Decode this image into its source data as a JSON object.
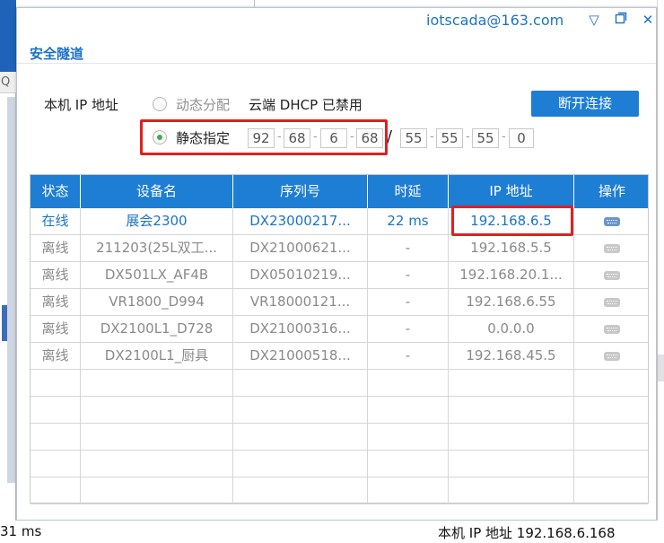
{
  "window": {
    "account": "iotscada@163.com",
    "title": "安全隧道"
  },
  "tunnel": {
    "local_ip_label": "本机 IP 地址",
    "mode_dynamic_label": "动态分配",
    "cloud_dhcp_label": "云端 DHCP 已禁用",
    "mode_static_label": "静态指定",
    "selected_mode": "静态指定",
    "ip": [
      "92",
      "68",
      "6",
      "68"
    ],
    "mask": [
      "55",
      "55",
      "55",
      "0"
    ],
    "disconnect_label": "断开连接"
  },
  "table": {
    "columns": [
      "状态",
      "设备名",
      "序列号",
      "时延",
      "IP 地址",
      "操作"
    ],
    "rows": [
      {
        "status": "在线",
        "name": "展会2300",
        "serial": "DX23000217...",
        "latency": "22 ms",
        "ip": "192.168.6.5",
        "online": true
      },
      {
        "status": "离线",
        "name": "211203(25L双工...",
        "serial": "DX21000621...",
        "latency": "-",
        "ip": "192.168.5.5",
        "online": false
      },
      {
        "status": "离线",
        "name": "DX501LX_AF4B",
        "serial": "DX05010219...",
        "latency": "-",
        "ip": "192.168.20.1...",
        "online": false
      },
      {
        "status": "离线",
        "name": "VR1800_D994",
        "serial": "VR18000121...",
        "latency": "-",
        "ip": "192.168.6.55",
        "online": false
      },
      {
        "status": "离线",
        "name": "DX2100L1_D728",
        "serial": "DX21000316...",
        "latency": "-",
        "ip": "0.0.0.0",
        "online": false
      },
      {
        "status": "离线",
        "name": "DX2100L1_厨具",
        "serial": "DX21000518...",
        "latency": "-",
        "ip": "192.168.45.5",
        "online": false
      }
    ],
    "empty_rows": 5
  },
  "statusbar": {
    "latency_text": "31 ms",
    "local_ip_text": "本机 IP 地址  192.168.6.168"
  },
  "colors": {
    "accent": "#1d7ed3",
    "highlight_border": "#e02020",
    "online_text": "#1b73c8",
    "offline_text": "#8a8a8a"
  },
  "icons": {
    "minimize": "chevron-down-icon",
    "restore": "restore-icon",
    "close": "close-icon",
    "operation": "connect-port-icon"
  }
}
